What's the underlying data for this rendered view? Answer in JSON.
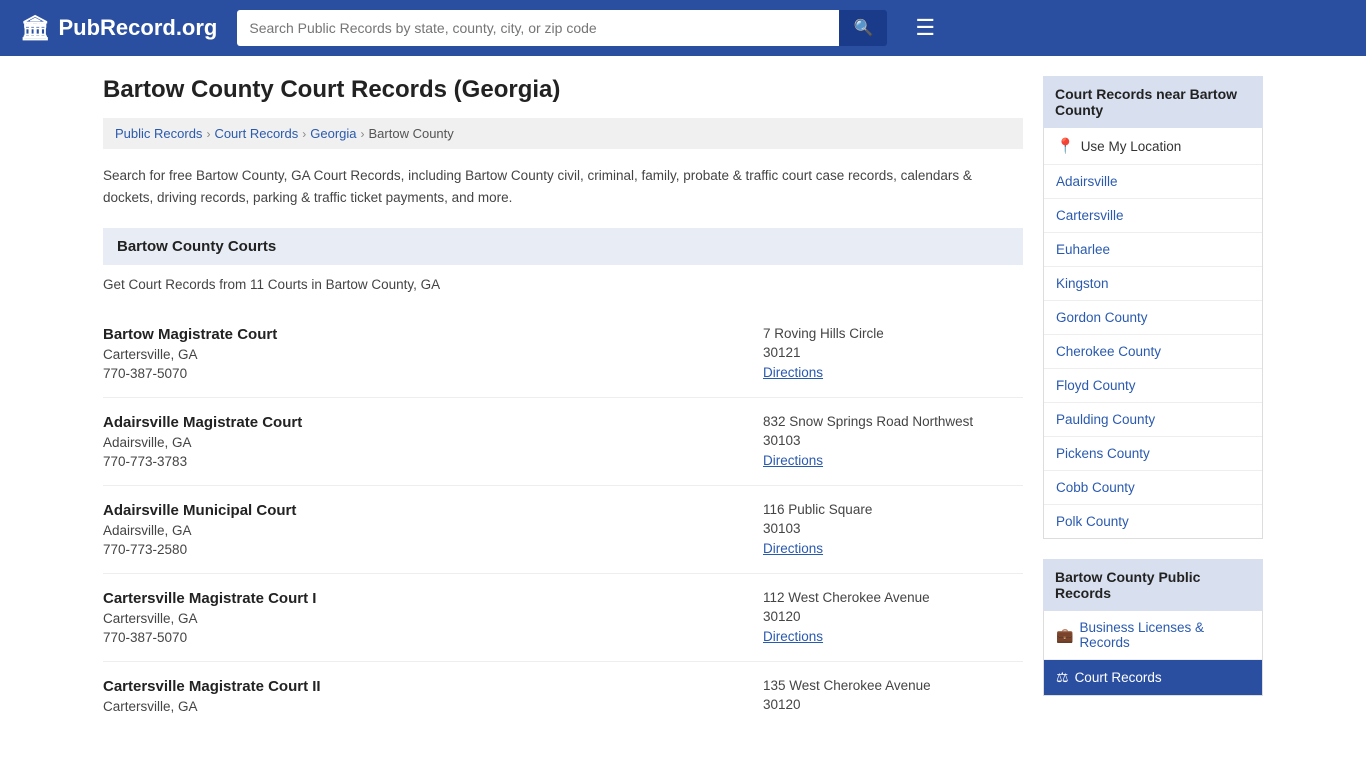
{
  "header": {
    "logo_icon": "🏛",
    "logo_text": "PubRecord.org",
    "search_placeholder": "Search Public Records by state, county, city, or zip code",
    "search_icon": "🔍",
    "menu_icon": "☰"
  },
  "page": {
    "title": "Bartow County Court Records (Georgia)",
    "description": "Search for free Bartow County, GA Court Records, including Bartow County civil, criminal, family, probate & traffic court case records, calendars & dockets, driving records, parking & traffic ticket payments, and more."
  },
  "breadcrumb": {
    "items": [
      "Public Records",
      "Court Records",
      "Georgia",
      "Bartow County"
    ],
    "separators": [
      ">",
      ">",
      ">"
    ]
  },
  "courts_section": {
    "header": "Bartow County Courts",
    "count_text": "Get Court Records from 11 Courts in Bartow County, GA"
  },
  "courts": [
    {
      "name": "Bartow Magistrate Court",
      "city": "Cartersville, GA",
      "phone": "770-387-5070",
      "address": "7 Roving Hills Circle",
      "zip": "30121",
      "directions_label": "Directions"
    },
    {
      "name": "Adairsville Magistrate Court",
      "city": "Adairsville, GA",
      "phone": "770-773-3783",
      "address": "832 Snow Springs Road Northwest",
      "zip": "30103",
      "directions_label": "Directions"
    },
    {
      "name": "Adairsville Municipal Court",
      "city": "Adairsville, GA",
      "phone": "770-773-2580",
      "address": "116 Public Square",
      "zip": "30103",
      "directions_label": "Directions"
    },
    {
      "name": "Cartersville Magistrate Court I",
      "city": "Cartersville, GA",
      "phone": "770-387-5070",
      "address": "112 West Cherokee Avenue",
      "zip": "30120",
      "directions_label": "Directions"
    },
    {
      "name": "Cartersville Magistrate Court II",
      "city": "Cartersville, GA",
      "phone": "",
      "address": "135 West Cherokee Avenue",
      "zip": "30120",
      "directions_label": ""
    }
  ],
  "sidebar": {
    "nearby_header": "Court Records near Bartow County",
    "use_location_label": "Use My Location",
    "nearby_items": [
      "Adairsville",
      "Cartersville",
      "Euharlee",
      "Kingston",
      "Gordon County",
      "Cherokee County",
      "Floyd County",
      "Paulding County",
      "Pickens County",
      "Cobb County",
      "Polk County"
    ],
    "public_records_header": "Bartow County Public Records",
    "public_records_items": [
      {
        "label": "Business Licenses & Records",
        "icon": "💼",
        "active": false
      },
      {
        "label": "Court Records",
        "icon": "⚖",
        "active": true
      }
    ]
  }
}
